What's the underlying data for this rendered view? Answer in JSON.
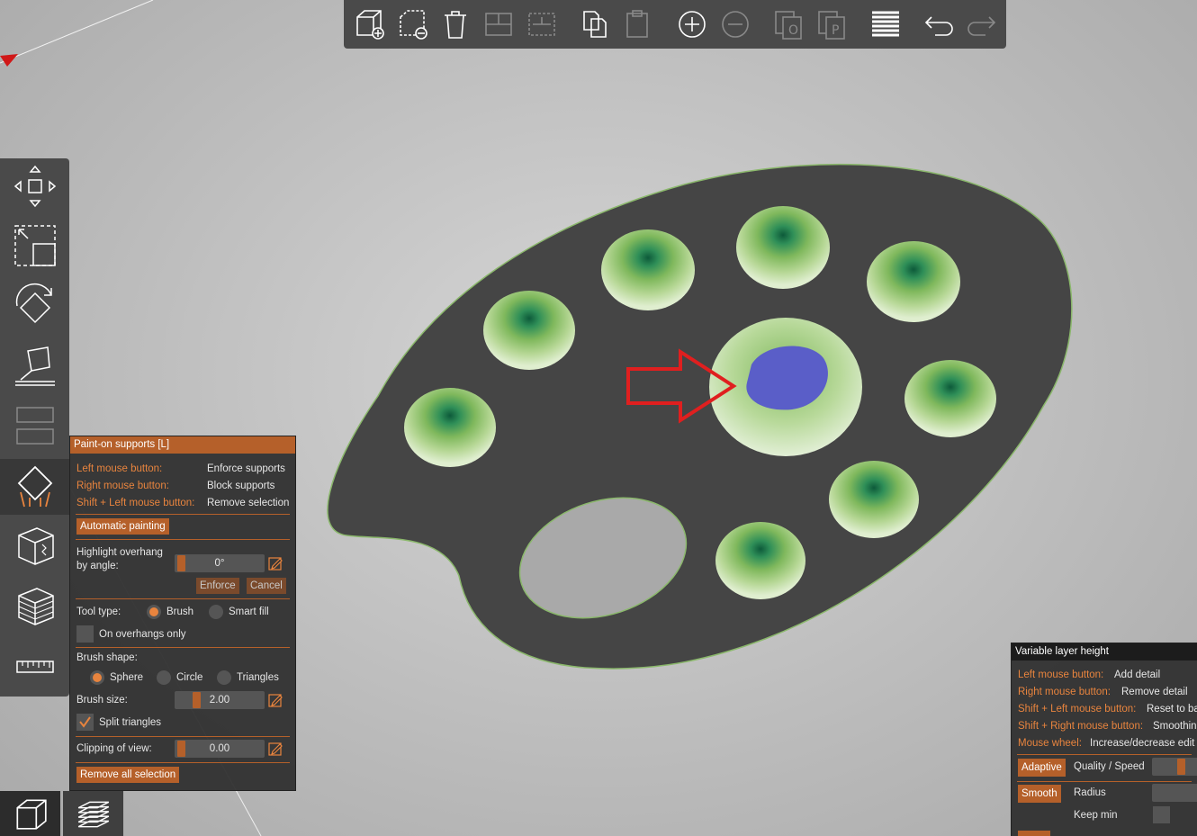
{
  "top_toolbar": {
    "buttons": [
      "add-icon",
      "delete-icon",
      "delete-all-icon",
      "arrange-icon",
      "arrange-selection-icon",
      "copy-icon",
      "paste-icon",
      "add-instance-icon",
      "remove-instance-icon",
      "split-objects-icon",
      "split-parts-icon",
      "layers-editing-icon",
      "undo-icon",
      "redo-icon"
    ]
  },
  "left_toolbar": {
    "tools": [
      "move-icon",
      "scale-icon",
      "rotate-icon",
      "place-on-face-icon",
      "cut-icon",
      "paint-supports-icon",
      "seam-paint-icon",
      "multimaterial-icon",
      "measure-icon"
    ]
  },
  "bottom_tabs": [
    "3d-view-icon",
    "preview-icon"
  ],
  "paint_panel": {
    "title": "Paint-on supports [L]",
    "left_mouse_label": "Left mouse button:",
    "left_mouse_value": "Enforce supports",
    "right_mouse_label": "Right mouse button:",
    "right_mouse_value": "Block supports",
    "shift_left_label": "Shift + Left mouse button:",
    "shift_left_value": "Remove selection",
    "auto_painting": "Automatic painting",
    "highlight_label_1": "Highlight overhang",
    "highlight_label_2": "by angle:",
    "highlight_value": "0°",
    "enforce": "Enforce",
    "cancel": "Cancel",
    "tool_type_label": "Tool type:",
    "tool_brush": "Brush",
    "tool_smart_fill": "Smart fill",
    "on_overhangs_only": "On overhangs only",
    "brush_shape_label": "Brush shape:",
    "shape_sphere": "Sphere",
    "shape_circle": "Circle",
    "shape_triangles": "Triangles",
    "brush_size_label": "Brush size:",
    "brush_size_value": "2.00",
    "split_triangles": "Split triangles",
    "clipping_label": "Clipping of view:",
    "clipping_value": "0.00",
    "remove_all": "Remove all selection"
  },
  "layer_panel": {
    "title": "Variable layer height",
    "left_mouse_label": "Left mouse button:",
    "left_mouse_value": "Add detail",
    "right_mouse_label": "Right mouse button:",
    "right_mouse_value": "Remove detail",
    "shift_left_label": "Shift + Left mouse button:",
    "shift_left_value": "Reset to ba",
    "shift_right_label": "Shift + Right mouse button:",
    "shift_right_value": "Smoothin",
    "wheel_label": "Mouse wheel:",
    "wheel_value": "Increase/decrease edit",
    "adaptive": "Adaptive",
    "quality_speed": "Quality / Speed",
    "smooth": "Smooth",
    "radius": "Radius",
    "keep_min": "Keep min"
  },
  "colors": {
    "accent": "#b5602a",
    "accent_text": "#e8843e",
    "panel_bg": "#303030",
    "toolbar_bg": "#4a4a4a",
    "model": "#444444",
    "wells": "#9bc27a",
    "painted": "#5a5ec8",
    "arrow": "#e01f1f"
  }
}
